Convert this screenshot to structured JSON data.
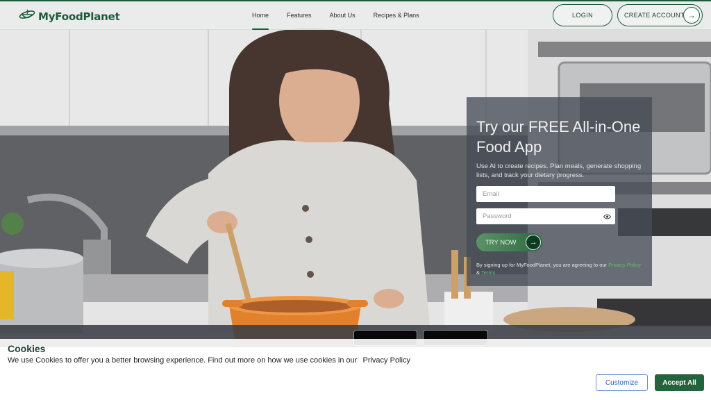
{
  "brand": {
    "name": "MyFoodPlanet",
    "icon": "planet-bowl-logo-icon",
    "color": "#1e5a3a"
  },
  "nav": {
    "links": [
      "Home",
      "Features",
      "About Us",
      "Recipes & Plans"
    ],
    "active": "Home",
    "login_label": "LOGIN",
    "create_account_label": "CREATE ACCOUNT",
    "create_account_icon": "arrow-right-icon"
  },
  "signup": {
    "title": "Try our FREE All-in-One Food App",
    "description": "Use AI to create recipes. Plan meals, generate shopping lists, and track your dietary progress.",
    "email_placeholder": "Email",
    "password_placeholder": "Password",
    "password_toggle_icon": "eye-icon",
    "try_label": "TRY NOW",
    "try_icon": "arrow-right-icon",
    "legal_prefix": "By signing up for MyFoodPlanet, you are agreeing to our",
    "privacy_link": "Privacy Policy",
    "ampersand": "&",
    "terms_link": "Terms"
  },
  "cookie": {
    "title": "Cookies",
    "text": "We use Cookies to offer you a better browsing experience. Find out more on how we use cookies in our",
    "policy_link": "Privacy Policy",
    "customize_label": "Customize",
    "accept_label": "Accept All"
  },
  "colors": {
    "accent": "#1e5a3a",
    "accept_button": "#24643c",
    "customize_border": "#6a8fd0",
    "card_bg": "#464c56"
  }
}
